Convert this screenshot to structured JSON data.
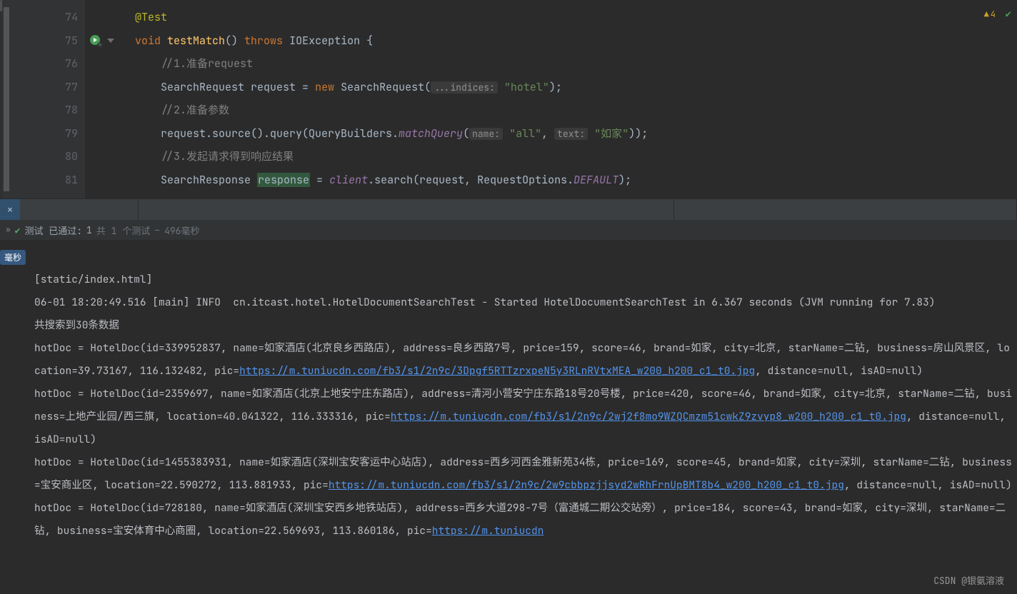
{
  "folder_label": "on",
  "warnings": {
    "symbol": "▲",
    "count": "4"
  },
  "gutter": [
    "74",
    "75",
    "76",
    "77",
    "78",
    "79",
    "80",
    "81"
  ],
  "code": {
    "l74": {
      "anno": "@Test"
    },
    "l75": {
      "kw1": "void ",
      "fn": "testMatch",
      "parens": "() ",
      "kw2": "throws ",
      "exc": "IOException ",
      "brace": "{"
    },
    "l76": {
      "cmt": "//1.准备request"
    },
    "l77": {
      "cls": "SearchRequest ",
      "var": "request",
      "eq": " = ",
      "kw": "new ",
      "ctor": "SearchRequest(",
      "hint": "...indices:",
      "sp": " ",
      "str": "\"hotel\"",
      "end": ");"
    },
    "l78": {
      "cmt": "//2.准备参数"
    },
    "l79": {
      "a": "request",
      "b": ".source().query(QueryBuilders.",
      "fn": "matchQuery",
      "op": "(",
      "h1": "name:",
      "s1": " ",
      "str1": "\"all\"",
      "c": ", ",
      "h2": "text:",
      "s2": " ",
      "str2": "\"如家\"",
      "end": "));"
    },
    "l80": {
      "cmt": "//3.发起请求得到响应结果"
    },
    "l81": {
      "cls": "SearchResponse ",
      "var": "response",
      "eq": " = ",
      "client": "client",
      "call": ".search(",
      "req": "request",
      "c": ", ",
      "opts": "RequestOptions.",
      "def": "DEFAULT",
      "end": ");"
    }
  },
  "status": {
    "close": "✕"
  },
  "test_bar": {
    "chev": "»",
    "check": "✔",
    "passed": "测试 已通过:",
    "count": " 1",
    "total": "共 1 个测试",
    "sep": " – ",
    "time": "496毫秒"
  },
  "run_badge": "毫秒",
  "console": {
    "l1": "[static/index.html]",
    "l2": "06-01 18:20:49.516 [main] INFO  cn.itcast.hotel.HotelDocumentSearchTest - Started HotelDocumentSearchTest in 6.367 seconds (JVM running for 7.83)",
    "l3": "共搜索到30条数据",
    "d1a": "hotDoc = HotelDoc(id=339952837, name=如家酒店(北京良乡西路店), address=良乡西路7号, price=159, score=46, brand=如家, city=北京, starName=二钻, business=房山风景区, location=39.73167, 116.132482, pic=",
    "d1link": "https://m.tuniucdn.com/fb3/s1/2n9c/3Dpgf5RTTzrxpeN5y3RLnRVtxMEA_w200_h200_c1_t0.jpg",
    "d1b": ", distance=null, isAD=null)",
    "d2a": "hotDoc = HotelDoc(id=2359697, name=如家酒店(北京上地安宁庄东路店), address=清河小营安宁庄东路18号20号楼, price=420, score=46, brand=如家, city=北京, starName=二钻, business=上地产业园/西三旗, location=40.041322, 116.333316, pic=",
    "d2link": "https://m.tuniucdn.com/fb3/s1/2n9c/2wj2f8mo9WZQCmzm51cwkZ9zvyp8_w200_h200_c1_t0.jpg",
    "d2b": ", distance=null, isAD=null)",
    "d3a": "hotDoc = HotelDoc(id=1455383931, name=如家酒店(深圳宝安客运中心站店), address=西乡河西金雅新苑34栋, price=169, score=45, brand=如家, city=深圳, starName=二钻, business=宝安商业区, location=22.590272, 113.881933, pic=",
    "d3link": "https://m.tuniucdn.com/fb3/s1/2n9c/2w9cbbpzjjsyd2wRhFrnUpBMT8b4_w200_h200_c1_t0.jpg",
    "d3b": ", distance=null, isAD=null)",
    "d4a": "hotDoc = HotelDoc(id=728180, name=如家酒店(深圳宝安西乡地铁站店), address=西乡大道298-7号（富通城二期公交站旁）, price=184, score=43, brand=如家, city=深圳, starName=二钻, business=宝安体育中心商圈, location=22.569693, 113.860186, pic=",
    "d4link": "https://m.tuniucdn"
  },
  "watermark": "CSDN @银氨溶液"
}
